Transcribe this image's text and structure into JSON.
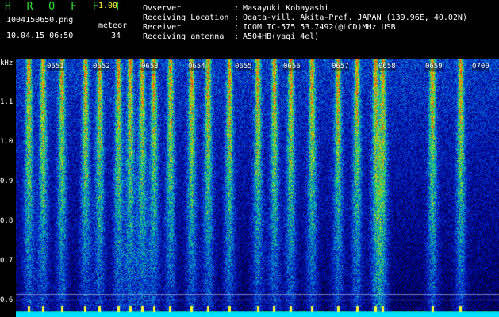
{
  "app": {
    "title": "H R O F F T",
    "version": "1.00"
  },
  "meta": {
    "filename": "1004150650.png",
    "datetime": "10.04.15 06:50",
    "meteor_label": "meteor",
    "meteor_count": "34"
  },
  "info": {
    "rows": [
      {
        "label": "Ovserver",
        "value": "Masayuki Kobayashi"
      },
      {
        "label": "Receiving Location",
        "value": "Ogata-vill. Akita-Pref. JAPAN (139.96E, 40.02N)"
      },
      {
        "label": "Receiver",
        "value": "ICOM IC-575 53.7492(@LCD)MHz USB"
      },
      {
        "label": "Receiving antenna",
        "value": "A504HB(yagi 4el)"
      }
    ]
  },
  "axes": {
    "y_unit": "kHz",
    "y_ticks": [
      "1.1",
      "1.0",
      "0.9",
      "0.8",
      "0.7",
      "0.6"
    ],
    "x_ticks": [
      "0651",
      "0652",
      "0653",
      "0654",
      "0655",
      "0656",
      "0657",
      "0658",
      "0659",
      "0700"
    ]
  },
  "spectrogram": {
    "y_range_khz": [
      0.58,
      1.18
    ],
    "meteor_streaks_minutes": [
      0.05,
      0.35,
      0.75,
      1.25,
      1.55,
      1.95,
      2.2,
      2.45,
      2.7,
      3.05,
      3.5,
      3.85,
      4.3,
      4.9,
      5.25,
      5.6,
      6.05,
      6.6,
      7.0,
      7.4,
      7.55,
      8.6,
      9.2
    ]
  },
  "colors": {
    "title": "#2ee02e",
    "version": "#ffff40",
    "background": "#000000"
  }
}
